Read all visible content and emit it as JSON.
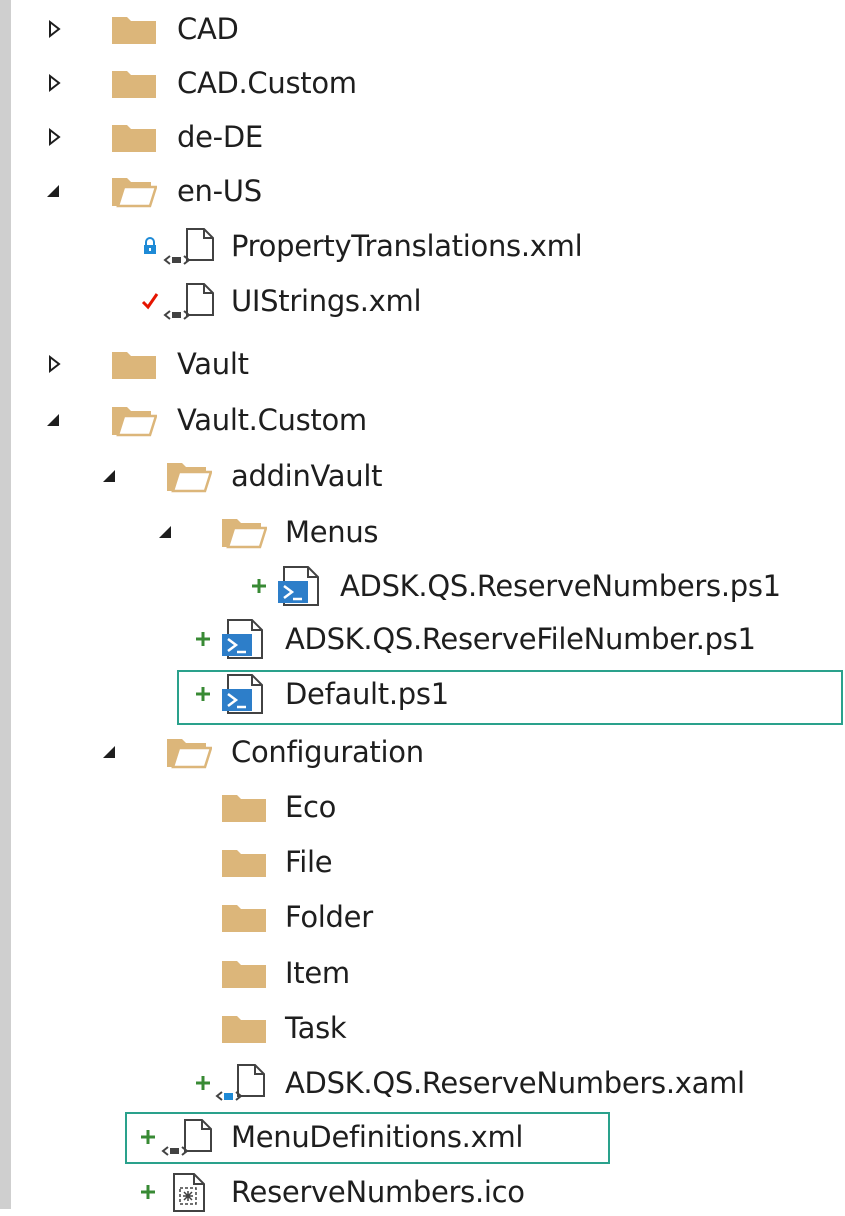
{
  "tree": {
    "nodes": [
      {
        "label": "CAD",
        "type": "folder",
        "state": "collapsed"
      },
      {
        "label": "CAD.Custom",
        "type": "folder",
        "state": "collapsed"
      },
      {
        "label": "de-DE",
        "type": "folder",
        "state": "collapsed"
      },
      {
        "label": "en-US",
        "type": "folder-open",
        "state": "expanded"
      },
      {
        "label": "PropertyTranslations.xml",
        "type": "xml-file",
        "status": "locked"
      },
      {
        "label": "UIStrings.xml",
        "type": "xml-file",
        "status": "checked-out"
      },
      {
        "label": "Vault",
        "type": "folder",
        "state": "collapsed"
      },
      {
        "label": "Vault.Custom",
        "type": "folder-open",
        "state": "expanded"
      },
      {
        "label": "addinVault",
        "type": "folder-open",
        "state": "expanded"
      },
      {
        "label": "Menus",
        "type": "folder-open",
        "state": "expanded"
      },
      {
        "label": "ADSK.QS.ReserveNumbers.ps1",
        "type": "ps1-file",
        "status": "added"
      },
      {
        "label": "ADSK.QS.ReserveFileNumber.ps1",
        "type": "ps1-file",
        "status": "added"
      },
      {
        "label": "Default.ps1",
        "type": "ps1-file",
        "status": "added",
        "highlighted": true
      },
      {
        "label": "Configuration",
        "type": "folder-open",
        "state": "expanded"
      },
      {
        "label": "Eco",
        "type": "folder"
      },
      {
        "label": "File",
        "type": "folder"
      },
      {
        "label": "Folder",
        "type": "folder"
      },
      {
        "label": "Item",
        "type": "folder"
      },
      {
        "label": "Task",
        "type": "folder"
      },
      {
        "label": "ADSK.QS.ReserveNumbers.xaml",
        "type": "xaml-file",
        "status": "added"
      },
      {
        "label": "MenuDefinitions.xml",
        "type": "xml-file",
        "status": "added",
        "highlighted": true
      },
      {
        "label": "ReserveNumbers.ico",
        "type": "ico-file",
        "status": "added"
      }
    ]
  },
  "colors": {
    "folder": "#dcb67a",
    "added": "#388a34",
    "checked_out": "#e51400",
    "locked": "#1e8ad6",
    "highlight_border": "#2aa18c",
    "ps1_blue": "#2d7ec9"
  }
}
